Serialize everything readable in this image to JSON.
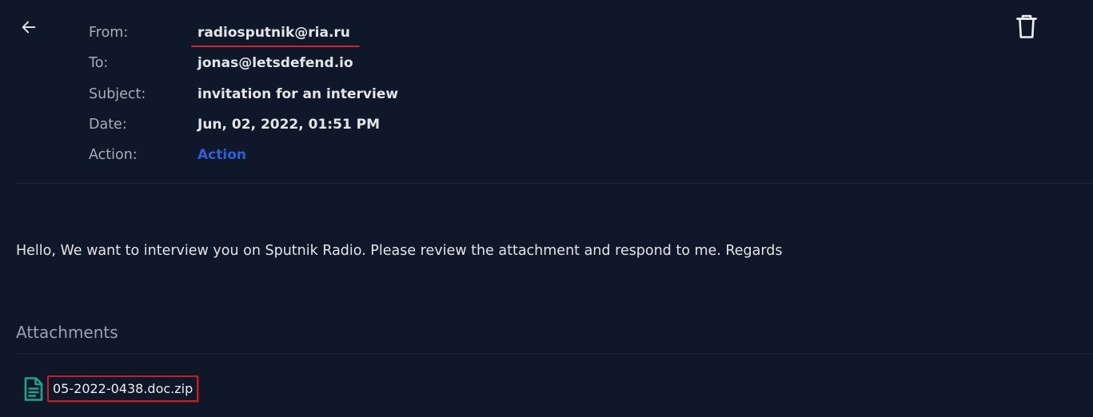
{
  "header": {
    "back_icon": "arrow-left-icon",
    "delete_icon": "trash-icon"
  },
  "email": {
    "from_label": "From:",
    "from_value": "radiosputnik@ria.ru",
    "to_label": "To:",
    "to_value": "jonas@letsdefend.io",
    "subject_label": "Subject:",
    "subject_value": "invitation for an interview",
    "date_label": "Date:",
    "date_value": "Jun, 02, 2022, 01:51 PM",
    "action_label": "Action:",
    "action_value": "Action",
    "body": "Hello, We want to interview you on Sputnik Radio. Please review the attachment and respond to me. Regards"
  },
  "attachments": {
    "heading": "Attachments",
    "items": [
      {
        "name": "05-2022-0438.doc.zip",
        "icon": "file-document-icon"
      }
    ]
  },
  "colors": {
    "background": "#0f1829",
    "link": "#2f5fd6",
    "highlight": "#d4242b",
    "file_icon": "#1fa58a"
  }
}
